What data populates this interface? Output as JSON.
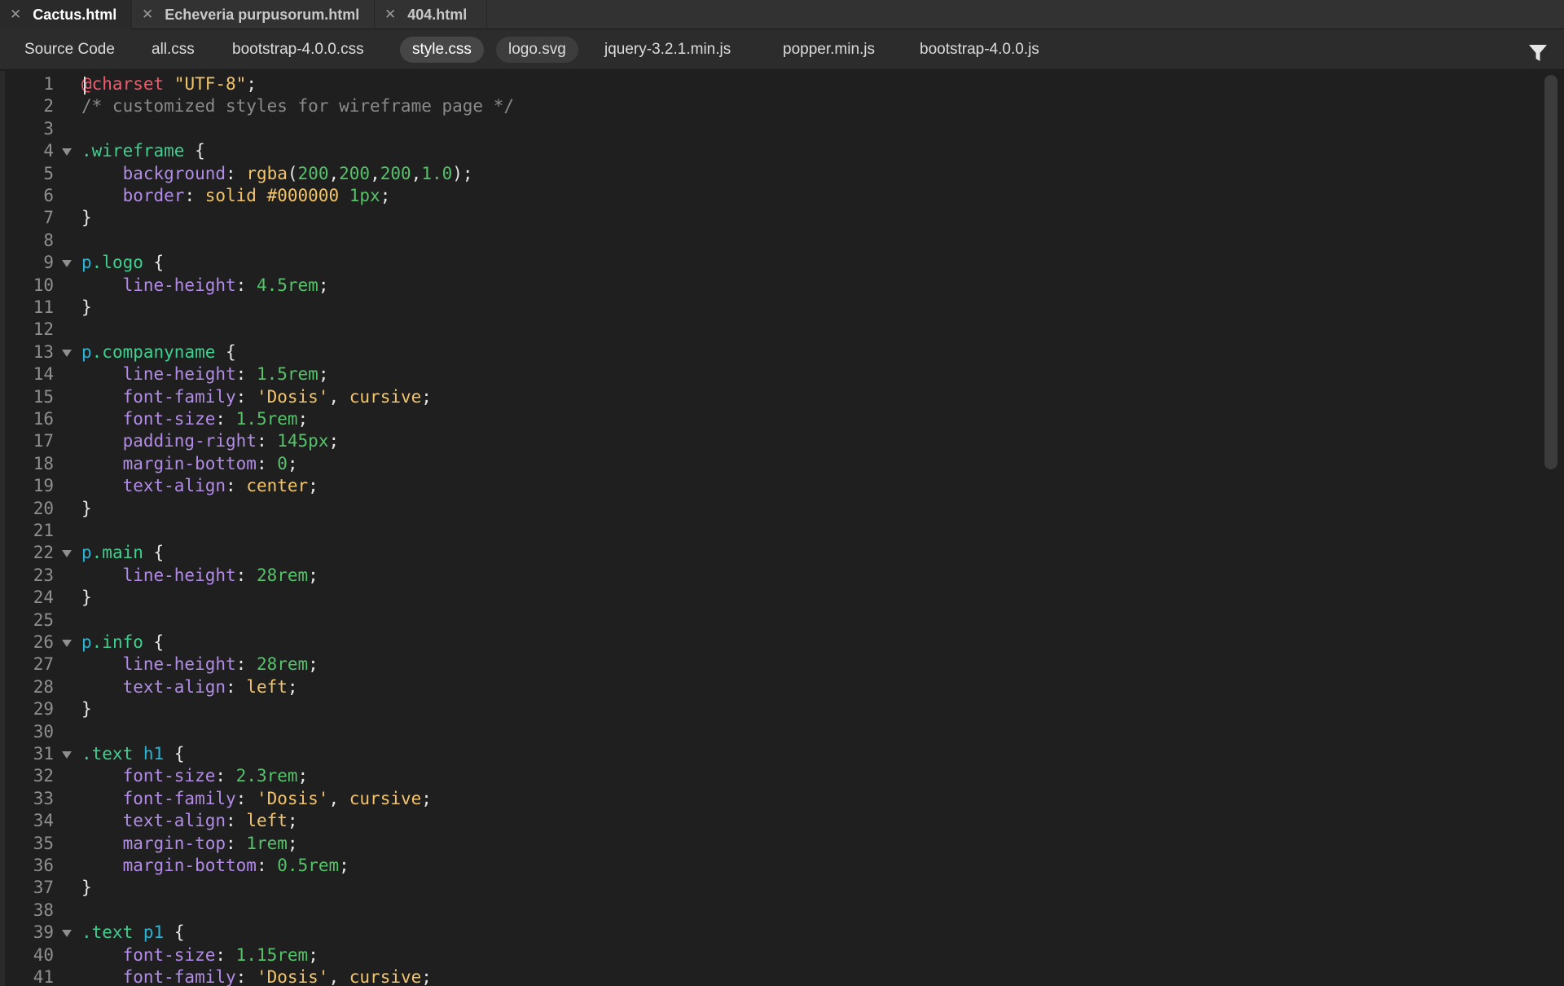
{
  "document_tabs": [
    {
      "label": "Cactus.html",
      "active": true
    },
    {
      "label": "Echeveria purpusorum.html",
      "active": false
    },
    {
      "label": "404.html",
      "active": false
    }
  ],
  "related_files": [
    {
      "label": "Source Code"
    },
    {
      "label": "all.css"
    },
    {
      "label": "bootstrap-4.0.0.css"
    },
    {
      "label": "style.css",
      "active": true
    },
    {
      "label": "logo.svg"
    },
    {
      "label": "jquery-3.2.1.min.js"
    },
    {
      "label": "popper.min.js"
    },
    {
      "label": "bootstrap-4.0.0.js"
    }
  ],
  "icons": {
    "close": "close-icon",
    "filter": "filter-icon",
    "fold": "fold-arrow-icon"
  },
  "colors": {
    "selector": "#3fcf8e",
    "property": "#b28ce6",
    "number": "#56c26a",
    "value": "#f3c56b",
    "comment": "#8a8a8a",
    "at_rule": "#f25a6b",
    "tag": "#29b6d6"
  },
  "code_lines": [
    {
      "n": "1",
      "fold": false,
      "tokens": [
        [
          "at",
          "@charset"
        ],
        [
          "pun",
          " "
        ],
        [
          "str",
          "\"UTF-8\""
        ],
        [
          "pun",
          ";"
        ]
      ]
    },
    {
      "n": "2",
      "fold": false,
      "tokens": [
        [
          "com",
          "/* customized styles for wireframe page */"
        ]
      ]
    },
    {
      "n": "3",
      "fold": false,
      "tokens": []
    },
    {
      "n": "4",
      "fold": true,
      "tokens": [
        [
          "sel",
          ".wireframe"
        ],
        [
          "pun",
          " {"
        ]
      ]
    },
    {
      "n": "5",
      "fold": false,
      "tokens": [
        [
          "pun",
          "    "
        ],
        [
          "prop",
          "background"
        ],
        [
          "pun",
          ": "
        ],
        [
          "val",
          "rgba"
        ],
        [
          "pun",
          "("
        ],
        [
          "num",
          "200"
        ],
        [
          "pun",
          ","
        ],
        [
          "num",
          "200"
        ],
        [
          "pun",
          ","
        ],
        [
          "num",
          "200"
        ],
        [
          "pun",
          ","
        ],
        [
          "num",
          "1.0"
        ],
        [
          "pun",
          ");"
        ]
      ]
    },
    {
      "n": "6",
      "fold": false,
      "tokens": [
        [
          "pun",
          "    "
        ],
        [
          "prop",
          "border"
        ],
        [
          "pun",
          ": "
        ],
        [
          "val",
          "solid #000000"
        ],
        [
          "pun",
          " "
        ],
        [
          "num",
          "1px"
        ],
        [
          "pun",
          ";"
        ]
      ]
    },
    {
      "n": "7",
      "fold": false,
      "tokens": [
        [
          "pun",
          "}"
        ]
      ]
    },
    {
      "n": "8",
      "fold": false,
      "tokens": []
    },
    {
      "n": "9",
      "fold": true,
      "tokens": [
        [
          "tag",
          "p"
        ],
        [
          "sel",
          ".logo"
        ],
        [
          "pun",
          " {"
        ]
      ]
    },
    {
      "n": "10",
      "fold": false,
      "tokens": [
        [
          "pun",
          "    "
        ],
        [
          "prop",
          "line-height"
        ],
        [
          "pun",
          ": "
        ],
        [
          "num",
          "4.5rem"
        ],
        [
          "pun",
          ";"
        ]
      ]
    },
    {
      "n": "11",
      "fold": false,
      "tokens": [
        [
          "pun",
          "}"
        ]
      ]
    },
    {
      "n": "12",
      "fold": false,
      "tokens": []
    },
    {
      "n": "13",
      "fold": true,
      "tokens": [
        [
          "tag",
          "p"
        ],
        [
          "sel",
          ".companyname"
        ],
        [
          "pun",
          " {"
        ]
      ]
    },
    {
      "n": "14",
      "fold": false,
      "tokens": [
        [
          "pun",
          "    "
        ],
        [
          "prop",
          "line-height"
        ],
        [
          "pun",
          ": "
        ],
        [
          "num",
          "1.5rem"
        ],
        [
          "pun",
          ";"
        ]
      ]
    },
    {
      "n": "15",
      "fold": false,
      "tokens": [
        [
          "pun",
          "    "
        ],
        [
          "prop",
          "font-family"
        ],
        [
          "pun",
          ": "
        ],
        [
          "str",
          "'Dosis'"
        ],
        [
          "pun",
          ", "
        ],
        [
          "val",
          "cursive"
        ],
        [
          "pun",
          ";"
        ]
      ]
    },
    {
      "n": "16",
      "fold": false,
      "tokens": [
        [
          "pun",
          "    "
        ],
        [
          "prop",
          "font-size"
        ],
        [
          "pun",
          ": "
        ],
        [
          "num",
          "1.5rem"
        ],
        [
          "pun",
          ";"
        ]
      ]
    },
    {
      "n": "17",
      "fold": false,
      "tokens": [
        [
          "pun",
          "    "
        ],
        [
          "prop",
          "padding-right"
        ],
        [
          "pun",
          ": "
        ],
        [
          "num",
          "145px"
        ],
        [
          "pun",
          ";"
        ]
      ]
    },
    {
      "n": "18",
      "fold": false,
      "tokens": [
        [
          "pun",
          "    "
        ],
        [
          "prop",
          "margin-bottom"
        ],
        [
          "pun",
          ": "
        ],
        [
          "num",
          "0"
        ],
        [
          "pun",
          ";"
        ]
      ]
    },
    {
      "n": "19",
      "fold": false,
      "tokens": [
        [
          "pun",
          "    "
        ],
        [
          "prop",
          "text-align"
        ],
        [
          "pun",
          ": "
        ],
        [
          "val",
          "center"
        ],
        [
          "pun",
          ";"
        ]
      ]
    },
    {
      "n": "20",
      "fold": false,
      "tokens": [
        [
          "pun",
          "}"
        ]
      ]
    },
    {
      "n": "21",
      "fold": false,
      "tokens": []
    },
    {
      "n": "22",
      "fold": true,
      "tokens": [
        [
          "tag",
          "p"
        ],
        [
          "sel",
          ".main"
        ],
        [
          "pun",
          " {"
        ]
      ]
    },
    {
      "n": "23",
      "fold": false,
      "tokens": [
        [
          "pun",
          "    "
        ],
        [
          "prop",
          "line-height"
        ],
        [
          "pun",
          ": "
        ],
        [
          "num",
          "28rem"
        ],
        [
          "pun",
          ";"
        ]
      ]
    },
    {
      "n": "24",
      "fold": false,
      "tokens": [
        [
          "pun",
          "}"
        ]
      ]
    },
    {
      "n": "25",
      "fold": false,
      "tokens": []
    },
    {
      "n": "26",
      "fold": true,
      "tokens": [
        [
          "tag",
          "p"
        ],
        [
          "sel",
          ".info"
        ],
        [
          "pun",
          " {"
        ]
      ]
    },
    {
      "n": "27",
      "fold": false,
      "tokens": [
        [
          "pun",
          "    "
        ],
        [
          "prop",
          "line-height"
        ],
        [
          "pun",
          ": "
        ],
        [
          "num",
          "28rem"
        ],
        [
          "pun",
          ";"
        ]
      ]
    },
    {
      "n": "28",
      "fold": false,
      "tokens": [
        [
          "pun",
          "    "
        ],
        [
          "prop",
          "text-align"
        ],
        [
          "pun",
          ": "
        ],
        [
          "val",
          "left"
        ],
        [
          "pun",
          ";"
        ]
      ]
    },
    {
      "n": "29",
      "fold": false,
      "tokens": [
        [
          "pun",
          "}"
        ]
      ]
    },
    {
      "n": "30",
      "fold": false,
      "tokens": []
    },
    {
      "n": "31",
      "fold": true,
      "tokens": [
        [
          "sel",
          ".text"
        ],
        [
          "pun",
          " "
        ],
        [
          "tag",
          "h1"
        ],
        [
          "pun",
          " {"
        ]
      ]
    },
    {
      "n": "32",
      "fold": false,
      "tokens": [
        [
          "pun",
          "    "
        ],
        [
          "prop",
          "font-size"
        ],
        [
          "pun",
          ": "
        ],
        [
          "num",
          "2.3rem"
        ],
        [
          "pun",
          ";"
        ]
      ]
    },
    {
      "n": "33",
      "fold": false,
      "tokens": [
        [
          "pun",
          "    "
        ],
        [
          "prop",
          "font-family"
        ],
        [
          "pun",
          ": "
        ],
        [
          "str",
          "'Dosis'"
        ],
        [
          "pun",
          ", "
        ],
        [
          "val",
          "cursive"
        ],
        [
          "pun",
          ";"
        ]
      ]
    },
    {
      "n": "34",
      "fold": false,
      "tokens": [
        [
          "pun",
          "    "
        ],
        [
          "prop",
          "text-align"
        ],
        [
          "pun",
          ": "
        ],
        [
          "val",
          "left"
        ],
        [
          "pun",
          ";"
        ]
      ]
    },
    {
      "n": "35",
      "fold": false,
      "tokens": [
        [
          "pun",
          "    "
        ],
        [
          "prop",
          "margin-top"
        ],
        [
          "pun",
          ": "
        ],
        [
          "num",
          "1rem"
        ],
        [
          "pun",
          ";"
        ]
      ]
    },
    {
      "n": "36",
      "fold": false,
      "tokens": [
        [
          "pun",
          "    "
        ],
        [
          "prop",
          "margin-bottom"
        ],
        [
          "pun",
          ": "
        ],
        [
          "num",
          "0.5rem"
        ],
        [
          "pun",
          ";"
        ]
      ]
    },
    {
      "n": "37",
      "fold": false,
      "tokens": [
        [
          "pun",
          "}"
        ]
      ]
    },
    {
      "n": "38",
      "fold": false,
      "tokens": []
    },
    {
      "n": "39",
      "fold": true,
      "tokens": [
        [
          "sel",
          ".text"
        ],
        [
          "pun",
          " "
        ],
        [
          "tag",
          "p1"
        ],
        [
          "pun",
          " {"
        ]
      ]
    },
    {
      "n": "40",
      "fold": false,
      "tokens": [
        [
          "pun",
          "    "
        ],
        [
          "prop",
          "font-size"
        ],
        [
          "pun",
          ": "
        ],
        [
          "num",
          "1.15rem"
        ],
        [
          "pun",
          ";"
        ]
      ]
    },
    {
      "n": "41",
      "fold": false,
      "tokens": [
        [
          "pun",
          "    "
        ],
        [
          "prop",
          "font-family"
        ],
        [
          "pun",
          ": "
        ],
        [
          "str",
          "'Dosis'"
        ],
        [
          "pun",
          ", "
        ],
        [
          "val",
          "cursive"
        ],
        [
          "pun",
          ";"
        ]
      ]
    }
  ]
}
